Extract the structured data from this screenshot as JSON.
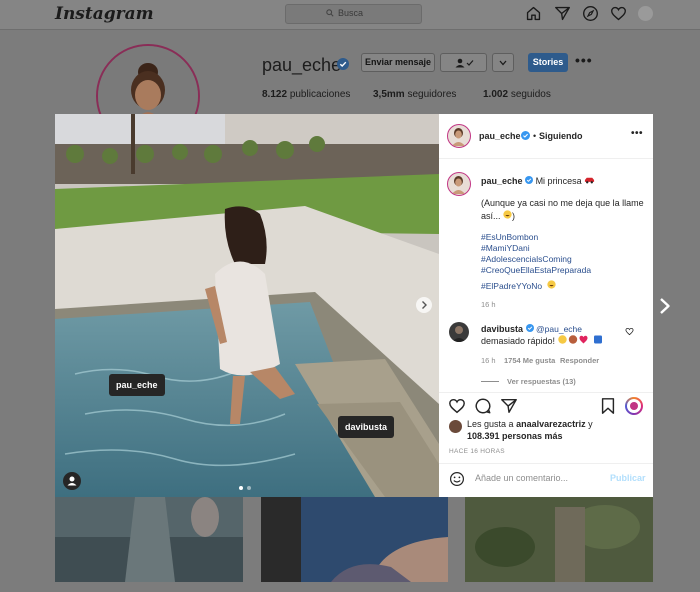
{
  "brand": "Instagram",
  "search": {
    "placeholder": "Busca"
  },
  "nav_icons": [
    "home-icon",
    "direct-icon",
    "explore-icon",
    "heart-icon",
    "avatar"
  ],
  "profile": {
    "username": "pau_eche",
    "verified": true,
    "message_button": "Enviar mensaje",
    "stories_button": "Stories",
    "stats": {
      "posts_count": "8.122",
      "posts_label": "publicaciones",
      "followers_count": "3,5mm",
      "followers_label": "seguidores",
      "following_count": "1.002",
      "following_label": "seguidos"
    }
  },
  "post": {
    "tags": [
      "pau_eche",
      "davibusta"
    ],
    "header": {
      "username": "pau_eche",
      "separator": "•",
      "status": "Siguiendo"
    },
    "caption": {
      "username": "pau_eche",
      "text": "Mi princesa",
      "line2": "(Aunque ya casi no me deja que la llame así... ",
      "hashtags": [
        "#EsUnBombon",
        "#MamiYDani",
        "#AdolescencialsComing",
        "#CreoQueEllaEstaPreparada",
        "#ElPadreYYoNo"
      ],
      "time": "16 h"
    },
    "comment": {
      "username": "davibusta",
      "mention": "@pau_eche",
      "text": "demasiado rápido!",
      "time": "16 h",
      "likes": "1754 Me gusta",
      "reply": "Responder",
      "view_replies": "Ver respuestas (13)"
    },
    "likes": {
      "prefix": "Les gusta a",
      "user": "anaalvarezactriz",
      "joiner": "y",
      "count": "108.391 personas más"
    },
    "timestamp": "HACE 16 HORAS",
    "add_comment_placeholder": "Añade un comentario...",
    "publish_label": "Publicar"
  },
  "colors": {
    "hashtag": "#2b4f8e",
    "stories_button": "#2e5b8c",
    "overlay": "#7c7c7c"
  }
}
